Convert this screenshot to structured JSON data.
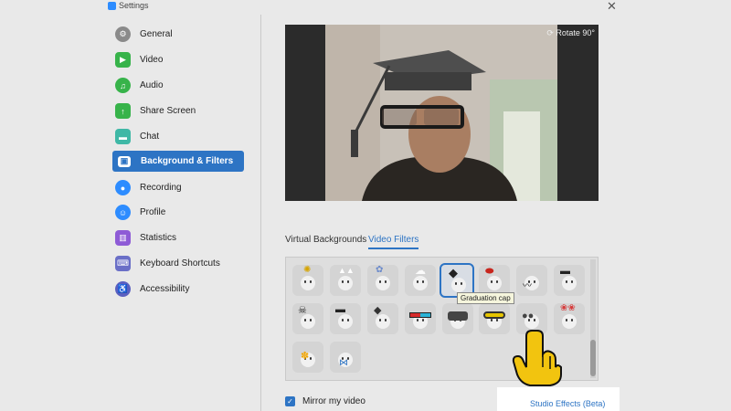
{
  "window": {
    "title": "Settings"
  },
  "sidebar": {
    "items": [
      {
        "label": "General",
        "icon": "gear-icon",
        "color": "#8a8a8a"
      },
      {
        "label": "Video",
        "icon": "video-camera-icon",
        "color": "#37b34a"
      },
      {
        "label": "Audio",
        "icon": "headphones-icon",
        "color": "#37b34a"
      },
      {
        "label": "Share Screen",
        "icon": "share-screen-icon",
        "color": "#37b34a"
      },
      {
        "label": "Chat",
        "icon": "chat-bubble-icon",
        "color": "#3fb8a6"
      },
      {
        "label": "Background & Filters",
        "icon": "background-icon",
        "color": "#2d74c4"
      },
      {
        "label": "Recording",
        "icon": "record-icon",
        "color": "#2d8cff"
      },
      {
        "label": "Profile",
        "icon": "profile-icon",
        "color": "#2d8cff"
      },
      {
        "label": "Statistics",
        "icon": "statistics-icon",
        "color": "#8e5bd6"
      },
      {
        "label": "Keyboard Shortcuts",
        "icon": "keyboard-icon",
        "color": "#6a6fc7"
      },
      {
        "label": "Accessibility",
        "icon": "accessibility-icon",
        "color": "#5a5fc0"
      }
    ],
    "active_index": 5
  },
  "preview": {
    "rotate_label": "Rotate 90°"
  },
  "tabs": {
    "virtual_backgrounds": "Virtual Backgrounds",
    "video_filters": "Video Filters"
  },
  "filters": {
    "selected": "Graduation cap",
    "tooltip": "Graduation cap",
    "items": [
      "sparkle-filter-icon",
      "bunny-ears-filter-icon",
      "flower-crown-filter-icon",
      "chef-hat-filter-icon",
      "graduation-cap-filter-icon",
      "beret-filter-icon",
      "mustache-filter-icon",
      "bandit-hat-filter-icon",
      "pirate-hat-filter-icon",
      "fedora-filter-icon",
      "mortarboard-filter-icon",
      "3d-glasses-filter-icon",
      "vr-headset-filter-icon",
      "ski-goggles-filter-icon",
      "round-glasses-filter-icon",
      "rose-crown-filter-icon",
      "daisy-filter-icon",
      "bowtie-filter-icon"
    ]
  },
  "footer": {
    "mirror_label": "Mirror my video",
    "mirror_checked": true,
    "studio_effects": "Studio Effects (Beta)"
  },
  "colors": {
    "accent": "#2d74c4",
    "window_bg": "#e9e9e9"
  }
}
